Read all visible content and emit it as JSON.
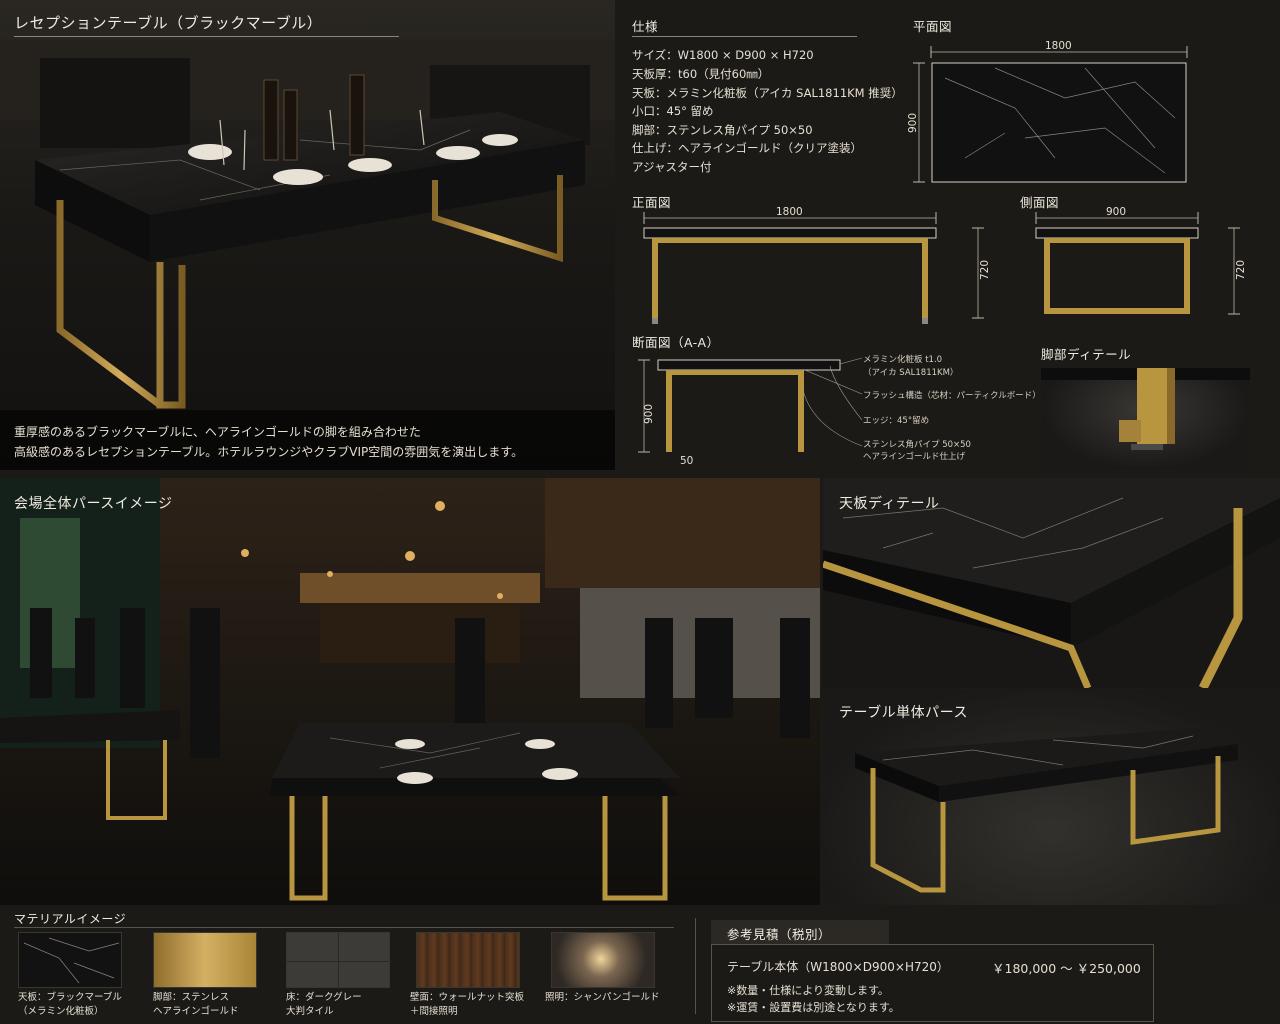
{
  "title": "レセプションテーブル（ブラックマーブル）",
  "description": {
    "line1": "重厚感のあるブラックマーブルに、ヘアラインゴールドの脚を組み合わせた",
    "line2": "高級感のあるレセプションテーブル。ホテルラウンジやクラブVIP空間の雰囲気を演出します。"
  },
  "spec": {
    "heading": "仕様",
    "lines": [
      "サイズ：W1800 × D900 × H720",
      "天板厚：t60（見付60㎜）",
      "天板：メラミン化粧板（アイカ SAL1811KM 推奨）",
      "小口：45° 留め",
      "脚部：ステンレス角パイプ 50×50",
      "仕上げ：ヘアラインゴールド（クリア塗装）",
      "アジャスター付"
    ]
  },
  "plan": {
    "heading": "平面図",
    "width": "1800",
    "depth": "900"
  },
  "front": {
    "heading": "正面図",
    "width": "1800",
    "height": "720"
  },
  "side": {
    "heading": "側面図",
    "width": "900",
    "height": "720"
  },
  "section": {
    "heading": "断面図（A-A）",
    "height": "900",
    "leg": "50",
    "callouts": [
      "メラミン化粧板 t1.0",
      "（アイカ SAL1811KM）",
      "フラッシュ構造（芯材：パーティクルボード）",
      "エッジ：45°留め",
      "ステンレス角パイプ 50×50",
      "ヘアラインゴールド仕上げ"
    ]
  },
  "leg_detail": {
    "heading": "脚部ディテール"
  },
  "venue": {
    "heading": "会場全体パースイメージ"
  },
  "top_detail": {
    "heading": "天板ディテール"
  },
  "single": {
    "heading": "テーブル単体パース"
  },
  "materials": {
    "heading": "マテリアルイメージ",
    "items": [
      {
        "line1": "天板：ブラックマーブル",
        "line2": "（メラミン化粧板）"
      },
      {
        "line1": "脚部：ステンレス",
        "line2": "ヘアラインゴールド"
      },
      {
        "line1": "床：ダークグレー",
        "line2": "大判タイル"
      },
      {
        "line1": "壁面：ウォールナット突板",
        "line2": "＋間接照明"
      },
      {
        "line1": "照明：シャンパンゴールド",
        "line2": ""
      }
    ]
  },
  "estimate": {
    "heading": "参考見積（税別）",
    "item": "テーブル本体（W1800×D900×H720）",
    "price": "￥180,000 〜 ￥250,000",
    "note1": "※数量・仕様により変動します。",
    "note2": "※運賃・設置費は別途となります。"
  },
  "colors": {
    "gold": "#b8953f",
    "marble": "#141414",
    "background": "#1c1a17"
  }
}
